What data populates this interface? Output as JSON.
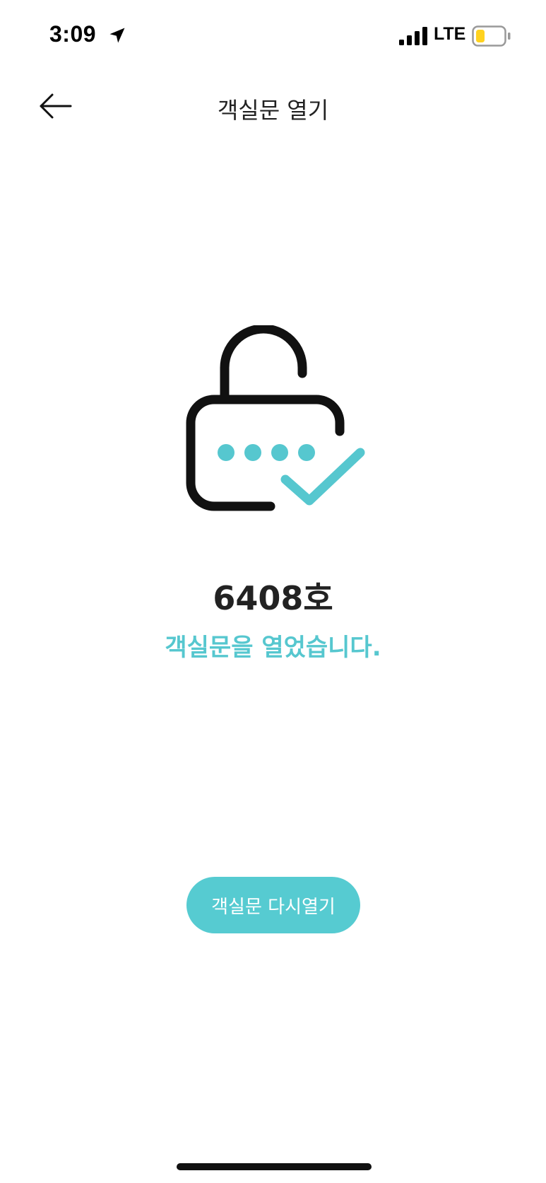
{
  "status_bar": {
    "time": "3:09",
    "network": "LTE",
    "icons": {
      "location": "location-arrow-icon",
      "signal": "cellular-signal-icon",
      "battery": "battery-low-icon"
    },
    "battery_level_fraction": 0.25,
    "battery_fill_color": "#ffd21f"
  },
  "header": {
    "title": "객실문 열기",
    "back_icon": "arrow-left-icon"
  },
  "illustration": {
    "icon": "unlocked-padlock-check-icon",
    "accent_color": "#56c7cf",
    "outline_color": "#111111"
  },
  "result": {
    "room_number": "6408호",
    "message": "객실문을 열었습니다."
  },
  "actions": {
    "reopen_label": "객실문 다시열기",
    "button_color": "#56cbd1"
  }
}
